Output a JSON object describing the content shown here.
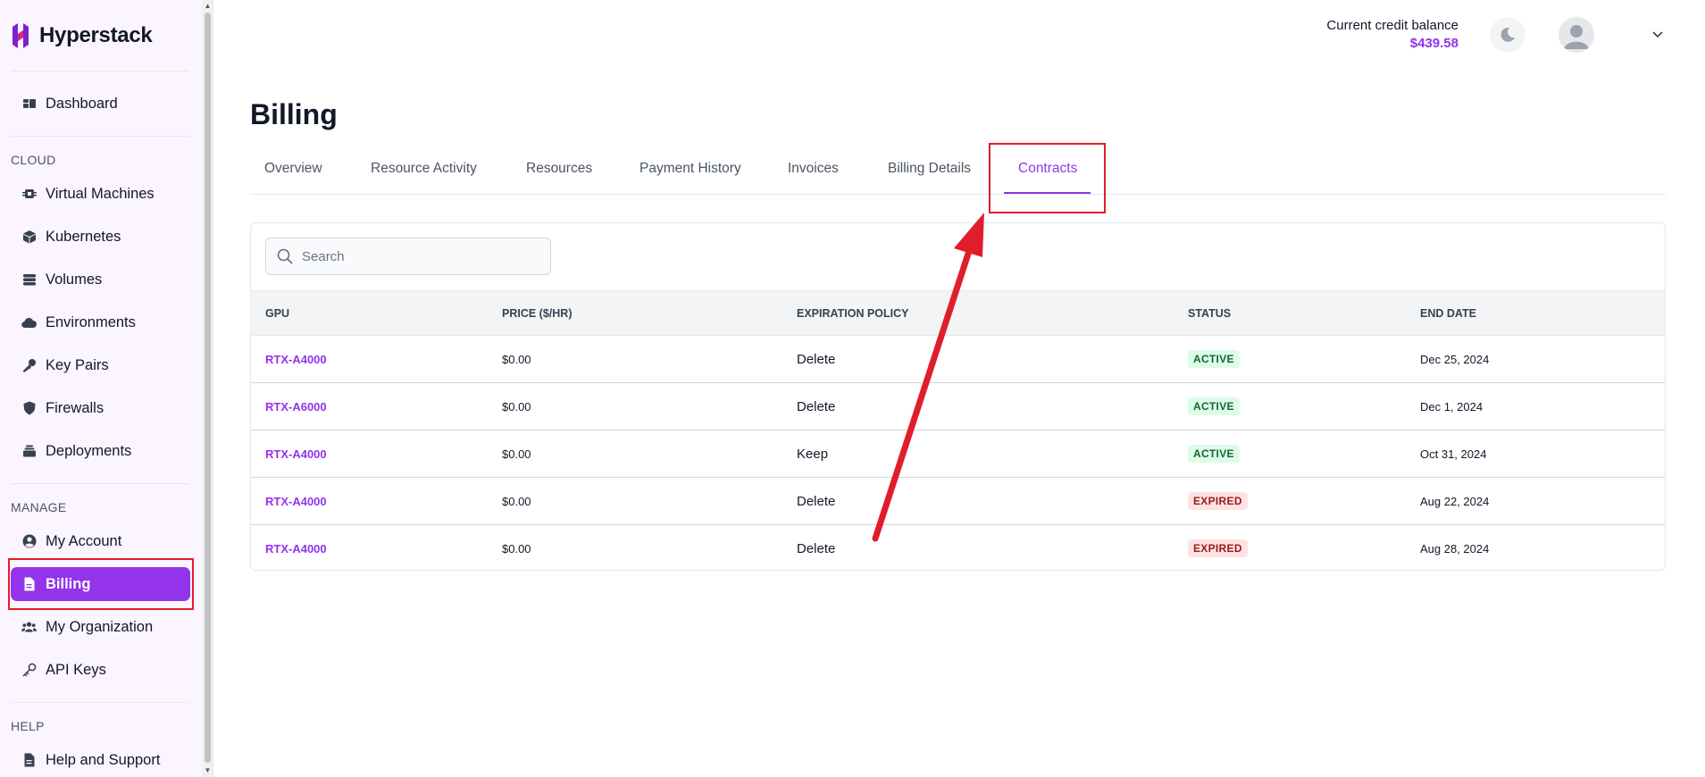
{
  "app": {
    "brand": "Hyperstack"
  },
  "sidebar": {
    "dashboard": "Dashboard",
    "sections": {
      "cloud": "CLOUD",
      "manage": "MANAGE",
      "help": "HELP"
    },
    "cloud_items": [
      {
        "label": "Virtual Machines",
        "icon": "chip-icon"
      },
      {
        "label": "Kubernetes",
        "icon": "cube-icon"
      },
      {
        "label": "Volumes",
        "icon": "database-icon"
      },
      {
        "label": "Environments",
        "icon": "cloud-icon"
      },
      {
        "label": "Key Pairs",
        "icon": "key-icon"
      },
      {
        "label": "Firewalls",
        "icon": "shield-icon"
      },
      {
        "label": "Deployments",
        "icon": "layers-icon"
      }
    ],
    "manage_items": [
      {
        "label": "My Account",
        "icon": "user-circle-icon"
      },
      {
        "label": "Billing",
        "icon": "document-icon",
        "active": true
      },
      {
        "label": "My Organization",
        "icon": "users-icon"
      },
      {
        "label": "API Keys",
        "icon": "key-outline-icon"
      }
    ],
    "help_items": [
      {
        "label": "Help and Support",
        "icon": "document-icon"
      }
    ]
  },
  "header": {
    "credit_label": "Current credit balance",
    "credit_value": "$439.58"
  },
  "page": {
    "title": "Billing",
    "tabs": [
      "Overview",
      "Resource Activity",
      "Resources",
      "Payment History",
      "Invoices",
      "Billing Details",
      "Contracts"
    ],
    "active_tab": "Contracts"
  },
  "search": {
    "placeholder": "Search",
    "value": ""
  },
  "table": {
    "columns": [
      "GPU",
      "PRICE ($/HR)",
      "EXPIRATION POLICY",
      "STATUS",
      "END DATE"
    ],
    "rows": [
      {
        "gpu": "RTX-A4000",
        "price": "$0.00",
        "policy": "Delete",
        "status": "ACTIVE",
        "end": "Dec 25, 2024"
      },
      {
        "gpu": "RTX-A6000",
        "price": "$0.00",
        "policy": "Delete",
        "status": "ACTIVE",
        "end": "Dec 1, 2024"
      },
      {
        "gpu": "RTX-A4000",
        "price": "$0.00",
        "policy": "Keep",
        "status": "ACTIVE",
        "end": "Oct 31, 2024"
      },
      {
        "gpu": "RTX-A4000",
        "price": "$0.00",
        "policy": "Delete",
        "status": "EXPIRED",
        "end": "Aug 22, 2024"
      },
      {
        "gpu": "RTX-A4000",
        "price": "$0.00",
        "policy": "Delete",
        "status": "EXPIRED",
        "end": "Aug 28, 2024"
      }
    ]
  },
  "colors": {
    "accent": "#9333ea",
    "annotation": "#e11d2b"
  }
}
